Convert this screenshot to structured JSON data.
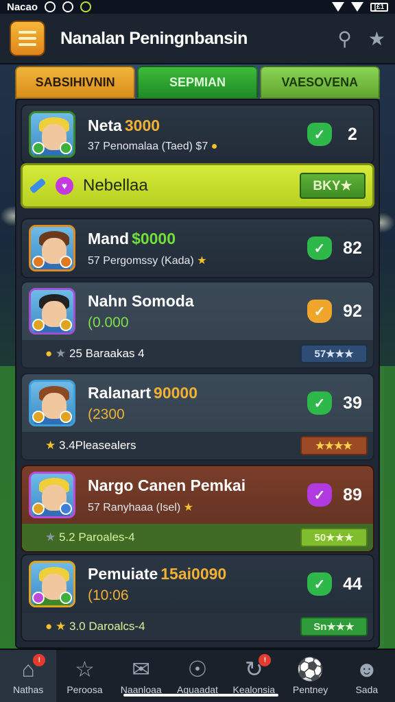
{
  "status_bar": {
    "time": "Nacao",
    "right_text": "[£1"
  },
  "header": {
    "title": "Nanalan Peningnbansin"
  },
  "tabs": [
    {
      "label": "SABSIHIVNIN"
    },
    {
      "label": "SEPMIAN"
    },
    {
      "label": "VAESOVENA"
    }
  ],
  "cards": [
    {
      "name": "Neta",
      "value": "3000",
      "meta": "37 Penomalaa (Taed) $7",
      "score": "2",
      "shield": "✓"
    },
    {
      "name": "Mand",
      "value": "$0000",
      "meta": "57 Pergomssy (Kada)",
      "score": "82",
      "shield": "✓"
    },
    {
      "name": "Nahn Somoda",
      "value": "(0.000",
      "meta": "",
      "score": "92",
      "shield": "✓",
      "sub_text": "25 Baraakas 4",
      "sub_button": "57★★★"
    },
    {
      "name": "Ralanart",
      "value": "90000",
      "meta_value": "(2300",
      "score": "39",
      "shield": "✓",
      "sub_text": "3.4Pleasealers",
      "sub_button": "★★★★"
    },
    {
      "name": "Nargo Canen Pemkai",
      "value": "",
      "meta": "57 Ranyhaaa (Isel)",
      "score": "89",
      "shield": "✓",
      "sub_text": "5.2 Paroales-4",
      "sub_button": "50★★★"
    },
    {
      "name": "Pemuiate",
      "value": "15ai0090",
      "meta_value": "(10:06",
      "score": "44",
      "shield": "✓",
      "sub_text": "3.0 Daroalcs-4",
      "sub_button": "Sn★★★"
    }
  ],
  "banner": {
    "label": "Nebellaa",
    "button": "BKY★"
  },
  "bottom_nav": [
    {
      "label": "Nathas",
      "icon": "home-icon"
    },
    {
      "label": "Peroosa",
      "icon": "star-icon"
    },
    {
      "label": "Naanloaa",
      "icon": "chat-icon"
    },
    {
      "label": "Aguaadat",
      "icon": "trophy-icon"
    },
    {
      "label": "Kealonsia",
      "icon": "refresh-icon"
    },
    {
      "label": "Pentney",
      "icon": "ball-icon"
    },
    {
      "label": "Sada",
      "icon": "user-icon"
    }
  ],
  "colors": {
    "accent_green": "#2eb84a",
    "accent_orange": "#f0a62a",
    "accent_purple": "#b13ae0",
    "banner_lime": "#c8df2c"
  }
}
